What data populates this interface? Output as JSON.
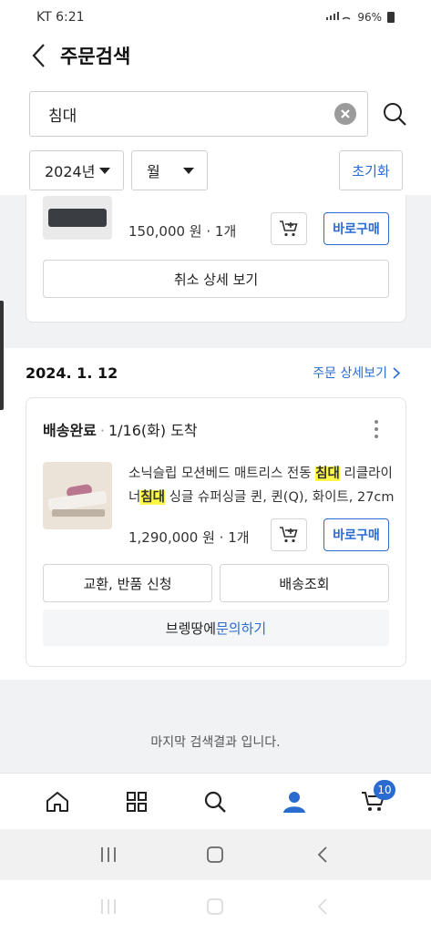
{
  "status_bar": {
    "time": "KT 6:21",
    "battery": "96%"
  },
  "header": {
    "title": "주문검색"
  },
  "search": {
    "query": "침대"
  },
  "filters": {
    "year": "2024년",
    "month": "월",
    "reset_label": "초기화"
  },
  "order_prev": {
    "price_qty": "150,000 원 · 1개",
    "buy_label": "바로구매",
    "cancel_detail_label": "취소 상세 보기"
  },
  "order": {
    "date": "2024. 1. 12",
    "detail_link": "주문 상세보기",
    "status": "배송완료",
    "arrival": "1/16(화) 도착",
    "product_name_1": "소닉슬립 모션베드 매트리스 전동 ",
    "product_name_hl1": "침대",
    "product_name_2": " 리클라이너",
    "product_name_hl2": "침대",
    "product_name_3": " 싱글 슈퍼싱글 퀸, 퀸(Q), 화이트, 27cm",
    "price_qty": "1,290,000 원 · 1개",
    "buy_label": "바로구매",
    "exchange_label": "교환, 반품 신청",
    "tracking_label": "배송조회",
    "inquiry_prefix": "브렝땅에 ",
    "inquiry_link": "문의하기"
  },
  "end_message": "마지막 검색결과 입니다.",
  "bottom_nav": {
    "cart_badge": "10"
  },
  "colors": {
    "accent": "#2a6bcf",
    "highlight": "#fff84a"
  }
}
